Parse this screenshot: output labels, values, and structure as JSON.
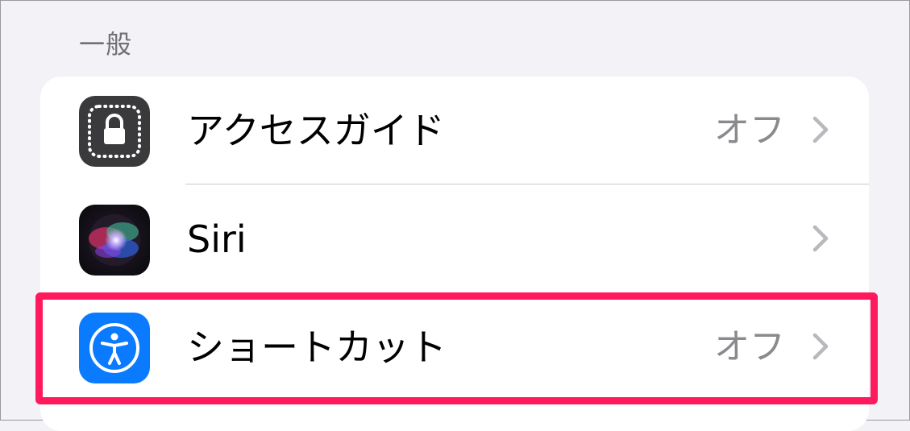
{
  "section_header": "一般",
  "rows": [
    {
      "label": "アクセスガイド",
      "value": "オフ",
      "icon": "guided-access-lock-icon",
      "icon_color": "#3a3a3c"
    },
    {
      "label": "Siri",
      "value": "",
      "icon": "siri-icon",
      "icon_color": "#1c1c1e"
    },
    {
      "label": "ショートカット",
      "value": "オフ",
      "icon": "accessibility-person-icon",
      "icon_color": "#0a7aff"
    }
  ],
  "highlight_color": "#ff1a5e"
}
